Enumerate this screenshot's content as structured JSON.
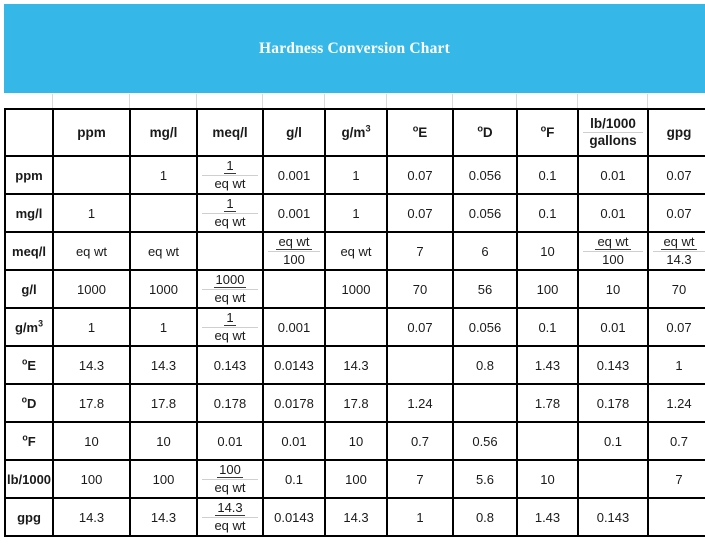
{
  "banner": {
    "title": "Hardness Conversion Chart",
    "background_color": "#35b8e8"
  },
  "table": {
    "corner_label": "",
    "column_headers": [
      {
        "label": "ppm",
        "type": "plain"
      },
      {
        "label": "mg/l",
        "type": "plain"
      },
      {
        "label": "meq/l",
        "type": "plain"
      },
      {
        "label": "g/l",
        "type": "plain"
      },
      {
        "label": "g/m3",
        "type": "superscript",
        "base": "g/m",
        "sup": "3"
      },
      {
        "label": "°E",
        "type": "degree",
        "base": "E"
      },
      {
        "label": "°D",
        "type": "degree",
        "base": "D"
      },
      {
        "label": "°F",
        "type": "degree",
        "base": "F"
      },
      {
        "label": "lb/1000 gallons",
        "type": "stacked",
        "top": "lb/1000",
        "bottom": "gallons"
      },
      {
        "label": "gpg",
        "type": "plain"
      }
    ],
    "row_headers": [
      {
        "label": "ppm",
        "type": "plain"
      },
      {
        "label": "mg/l",
        "type": "plain"
      },
      {
        "label": "meq/l",
        "type": "plain"
      },
      {
        "label": "g/l",
        "type": "plain"
      },
      {
        "label": "g/m3",
        "type": "superscript",
        "base": "g/m",
        "sup": "3"
      },
      {
        "label": "°E",
        "type": "degree",
        "base": "E"
      },
      {
        "label": "°D",
        "type": "degree",
        "base": "D"
      },
      {
        "label": "°F",
        "type": "degree",
        "base": "F"
      },
      {
        "label": "lb/1000",
        "type": "plain"
      },
      {
        "label": "gpg",
        "type": "plain"
      }
    ],
    "rows": [
      {
        "header": "ppm",
        "cells": [
          {
            "kind": "diagonal"
          },
          {
            "kind": "value",
            "text": "1"
          },
          {
            "kind": "fraction",
            "num": "1",
            "den": "eq wt"
          },
          {
            "kind": "value",
            "text": "0.001"
          },
          {
            "kind": "value",
            "text": "1"
          },
          {
            "kind": "value",
            "text": "0.07"
          },
          {
            "kind": "value",
            "text": "0.056"
          },
          {
            "kind": "value",
            "text": "0.1"
          },
          {
            "kind": "value",
            "text": "0.01"
          },
          {
            "kind": "value",
            "text": "0.07"
          }
        ]
      },
      {
        "header": "mg/l",
        "cells": [
          {
            "kind": "value",
            "text": "1"
          },
          {
            "kind": "diagonal"
          },
          {
            "kind": "fraction",
            "num": "1",
            "den": "eq wt"
          },
          {
            "kind": "value",
            "text": "0.001"
          },
          {
            "kind": "value",
            "text": "1"
          },
          {
            "kind": "value",
            "text": "0.07"
          },
          {
            "kind": "value",
            "text": "0.056"
          },
          {
            "kind": "value",
            "text": "0.1"
          },
          {
            "kind": "value",
            "text": "0.01"
          },
          {
            "kind": "value",
            "text": "0.07"
          }
        ]
      },
      {
        "header": "meq/l",
        "cells": [
          {
            "kind": "value",
            "text": "eq wt"
          },
          {
            "kind": "value",
            "text": "eq wt"
          },
          {
            "kind": "diagonal"
          },
          {
            "kind": "fraction",
            "num": "eq wt",
            "den": "100"
          },
          {
            "kind": "value",
            "text": "eq wt"
          },
          {
            "kind": "value",
            "text": "7"
          },
          {
            "kind": "value",
            "text": "6"
          },
          {
            "kind": "value",
            "text": "10"
          },
          {
            "kind": "fraction",
            "num": "eq wt",
            "den": "100"
          },
          {
            "kind": "fraction",
            "num": "eq wt",
            "den": "14.3"
          }
        ]
      },
      {
        "header": "g/l",
        "cells": [
          {
            "kind": "value",
            "text": "1000"
          },
          {
            "kind": "value",
            "text": "1000"
          },
          {
            "kind": "fraction",
            "num": "1000",
            "den": "eq wt"
          },
          {
            "kind": "diagonal"
          },
          {
            "kind": "value",
            "text": "1000"
          },
          {
            "kind": "value",
            "text": "70"
          },
          {
            "kind": "value",
            "text": "56"
          },
          {
            "kind": "value",
            "text": "100"
          },
          {
            "kind": "value",
            "text": "10"
          },
          {
            "kind": "value",
            "text": "70"
          }
        ]
      },
      {
        "header": "g/m3",
        "cells": [
          {
            "kind": "value",
            "text": "1"
          },
          {
            "kind": "value",
            "text": "1"
          },
          {
            "kind": "fraction",
            "num": "1",
            "den": "eq wt"
          },
          {
            "kind": "value",
            "text": "0.001"
          },
          {
            "kind": "diagonal"
          },
          {
            "kind": "value",
            "text": "0.07"
          },
          {
            "kind": "value",
            "text": "0.056"
          },
          {
            "kind": "value",
            "text": "0.1"
          },
          {
            "kind": "value",
            "text": "0.01"
          },
          {
            "kind": "value",
            "text": "0.07"
          }
        ]
      },
      {
        "header": "°E",
        "cells": [
          {
            "kind": "value",
            "text": "14.3"
          },
          {
            "kind": "value",
            "text": "14.3"
          },
          {
            "kind": "value",
            "text": "0.143"
          },
          {
            "kind": "value",
            "text": "0.0143"
          },
          {
            "kind": "value",
            "text": "14.3"
          },
          {
            "kind": "diagonal"
          },
          {
            "kind": "value",
            "text": "0.8"
          },
          {
            "kind": "value",
            "text": "1.43"
          },
          {
            "kind": "value",
            "text": "0.143"
          },
          {
            "kind": "value",
            "text": "1"
          }
        ]
      },
      {
        "header": "°D",
        "cells": [
          {
            "kind": "value",
            "text": "17.8"
          },
          {
            "kind": "value",
            "text": "17.8"
          },
          {
            "kind": "value",
            "text": "0.178"
          },
          {
            "kind": "value",
            "text": "0.0178"
          },
          {
            "kind": "value",
            "text": "17.8"
          },
          {
            "kind": "value",
            "text": "1.24"
          },
          {
            "kind": "diagonal"
          },
          {
            "kind": "value",
            "text": "1.78"
          },
          {
            "kind": "value",
            "text": "0.178"
          },
          {
            "kind": "value",
            "text": "1.24"
          }
        ]
      },
      {
        "header": "°F",
        "cells": [
          {
            "kind": "value",
            "text": "10"
          },
          {
            "kind": "value",
            "text": "10"
          },
          {
            "kind": "value",
            "text": "0.01"
          },
          {
            "kind": "value",
            "text": "0.01"
          },
          {
            "kind": "value",
            "text": "10"
          },
          {
            "kind": "value",
            "text": "0.7"
          },
          {
            "kind": "value",
            "text": "0.56"
          },
          {
            "kind": "diagonal"
          },
          {
            "kind": "value",
            "text": "0.1"
          },
          {
            "kind": "value",
            "text": "0.7"
          }
        ]
      },
      {
        "header": "lb/1000",
        "cells": [
          {
            "kind": "value",
            "text": "100"
          },
          {
            "kind": "value",
            "text": "100"
          },
          {
            "kind": "fraction",
            "num": "100",
            "den": "eq wt"
          },
          {
            "kind": "value",
            "text": "0.1"
          },
          {
            "kind": "value",
            "text": "100"
          },
          {
            "kind": "value",
            "text": "7"
          },
          {
            "kind": "value",
            "text": "5.6"
          },
          {
            "kind": "value",
            "text": "10"
          },
          {
            "kind": "diagonal"
          },
          {
            "kind": "value",
            "text": "7"
          }
        ]
      },
      {
        "header": "gpg",
        "cells": [
          {
            "kind": "value",
            "text": "14.3"
          },
          {
            "kind": "value",
            "text": "14.3"
          },
          {
            "kind": "fraction",
            "num": "14.3",
            "den": "eq wt"
          },
          {
            "kind": "value",
            "text": "0.0143"
          },
          {
            "kind": "value",
            "text": "14.3"
          },
          {
            "kind": "value",
            "text": "1"
          },
          {
            "kind": "value",
            "text": "0.8"
          },
          {
            "kind": "value",
            "text": "1.43"
          },
          {
            "kind": "value",
            "text": "0.143"
          },
          {
            "kind": "diagonal"
          }
        ]
      }
    ]
  }
}
